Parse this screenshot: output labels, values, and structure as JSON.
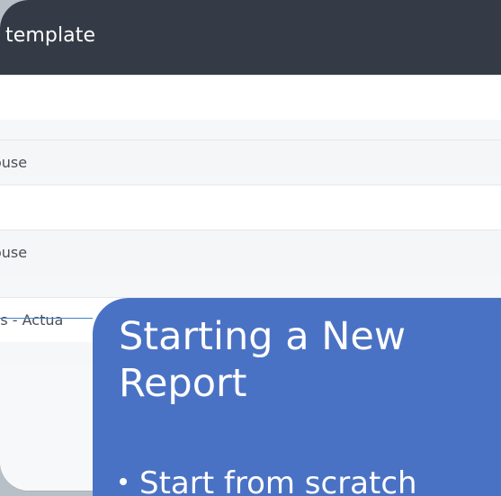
{
  "window": {
    "title": "template"
  },
  "rows": [
    {
      "text": ""
    },
    {
      "text": "ouse"
    },
    {
      "text": ""
    },
    {
      "text": "ouse"
    },
    {
      "text": "ss - Actua"
    },
    {
      "text": ""
    }
  ],
  "slide": {
    "title": "Starting a New Report",
    "bullet": "Start from scratch"
  },
  "colors": {
    "background": "#b7c0c6",
    "header": "#343b46",
    "card": "#4a72c4",
    "accent": "#3d84c6"
  }
}
